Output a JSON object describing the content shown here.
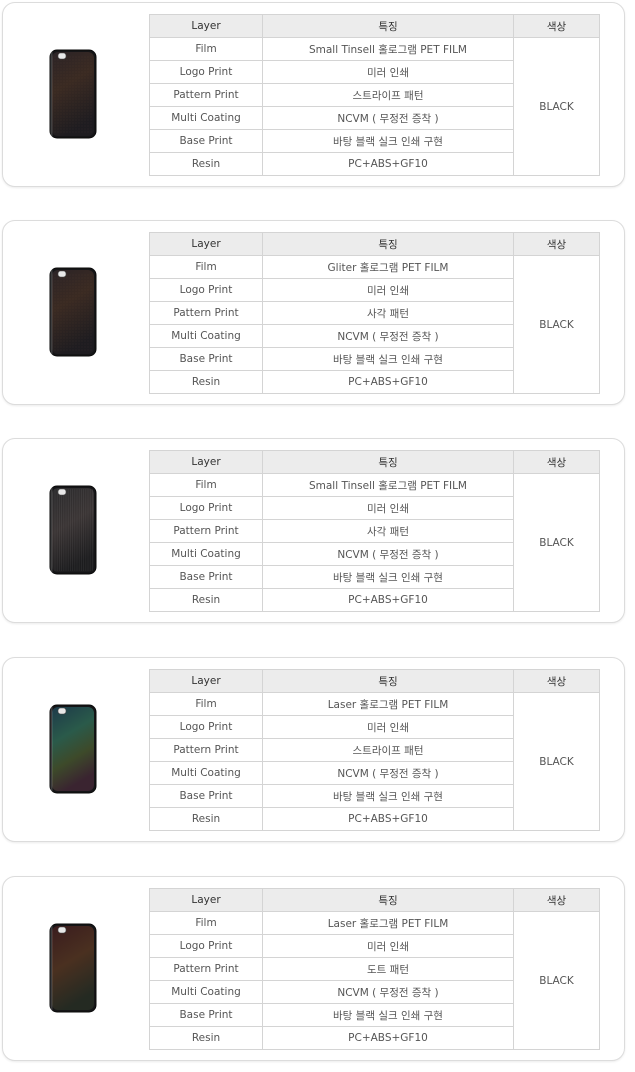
{
  "headers": {
    "layer": "Layer",
    "feature": "특징",
    "color": "색상"
  },
  "cards": [
    {
      "color_value": "BLACK",
      "phone_style": "dark-glitter",
      "rows": [
        {
          "layer": "Film",
          "feature": "Small Tinsell 홀로그램 PET FILM"
        },
        {
          "layer": "Logo Print",
          "feature": "미러 인쇄"
        },
        {
          "layer": "Pattern Print",
          "feature": "스트라이프 패턴"
        },
        {
          "layer": "Multi Coating",
          "feature": "NCVM ( 무정전 증착 )"
        },
        {
          "layer": "Base Print",
          "feature": "바탕 블랙 실크 인쇄 구현"
        },
        {
          "layer": "Resin",
          "feature": "PC+ABS+GF10"
        }
      ]
    },
    {
      "color_value": "BLACK",
      "phone_style": "dark-glitter",
      "rows": [
        {
          "layer": "Film",
          "feature": "Gliter 홀로그램 PET FILM"
        },
        {
          "layer": "Logo Print",
          "feature": "미러 인쇄"
        },
        {
          "layer": "Pattern Print",
          "feature": "사각 패턴"
        },
        {
          "layer": "Multi Coating",
          "feature": "NCVM ( 무정전 증착 )"
        },
        {
          "layer": "Base Print",
          "feature": "바탕 블랙 실크 인쇄 구현"
        },
        {
          "layer": "Resin",
          "feature": "PC+ABS+GF10"
        }
      ]
    },
    {
      "color_value": "BLACK",
      "phone_style": "dark-stripe",
      "rows": [
        {
          "layer": "Film",
          "feature": "Small Tinsell 홀로그램 PET FILM"
        },
        {
          "layer": "Logo Print",
          "feature": "미러 인쇄"
        },
        {
          "layer": "Pattern Print",
          "feature": "사각 패턴"
        },
        {
          "layer": "Multi Coating",
          "feature": "NCVM ( 무정전 증착 )"
        },
        {
          "layer": "Base Print",
          "feature": "바탕 블랙 실크 인쇄 구현"
        },
        {
          "layer": "Resin",
          "feature": "PC+ABS+GF10"
        }
      ]
    },
    {
      "color_value": "BLACK",
      "phone_style": "laser-blue",
      "rows": [
        {
          "layer": "Film",
          "feature": "Laser 홀로그램 PET FILM"
        },
        {
          "layer": "Logo Print",
          "feature": "미러 인쇄"
        },
        {
          "layer": "Pattern Print",
          "feature": "스트라이프 패턴"
        },
        {
          "layer": "Multi Coating",
          "feature": "NCVM ( 무정전 증착 )"
        },
        {
          "layer": "Base Print",
          "feature": "바탕 블랙 실크 인쇄 구현"
        },
        {
          "layer": "Resin",
          "feature": "PC+ABS+GF10"
        }
      ]
    },
    {
      "color_value": "BLACK",
      "phone_style": "laser-red",
      "rows": [
        {
          "layer": "Film",
          "feature": "Laser 홀로그램 PET FILM"
        },
        {
          "layer": "Logo Print",
          "feature": "미러 인쇄"
        },
        {
          "layer": "Pattern Print",
          "feature": "도트 패턴"
        },
        {
          "layer": "Multi Coating",
          "feature": "NCVM ( 무정전 증착 )"
        },
        {
          "layer": "Base Print",
          "feature": "바탕 블랙 실크 인쇄 구현"
        },
        {
          "layer": "Resin",
          "feature": "PC+ABS+GF10"
        }
      ]
    }
  ]
}
